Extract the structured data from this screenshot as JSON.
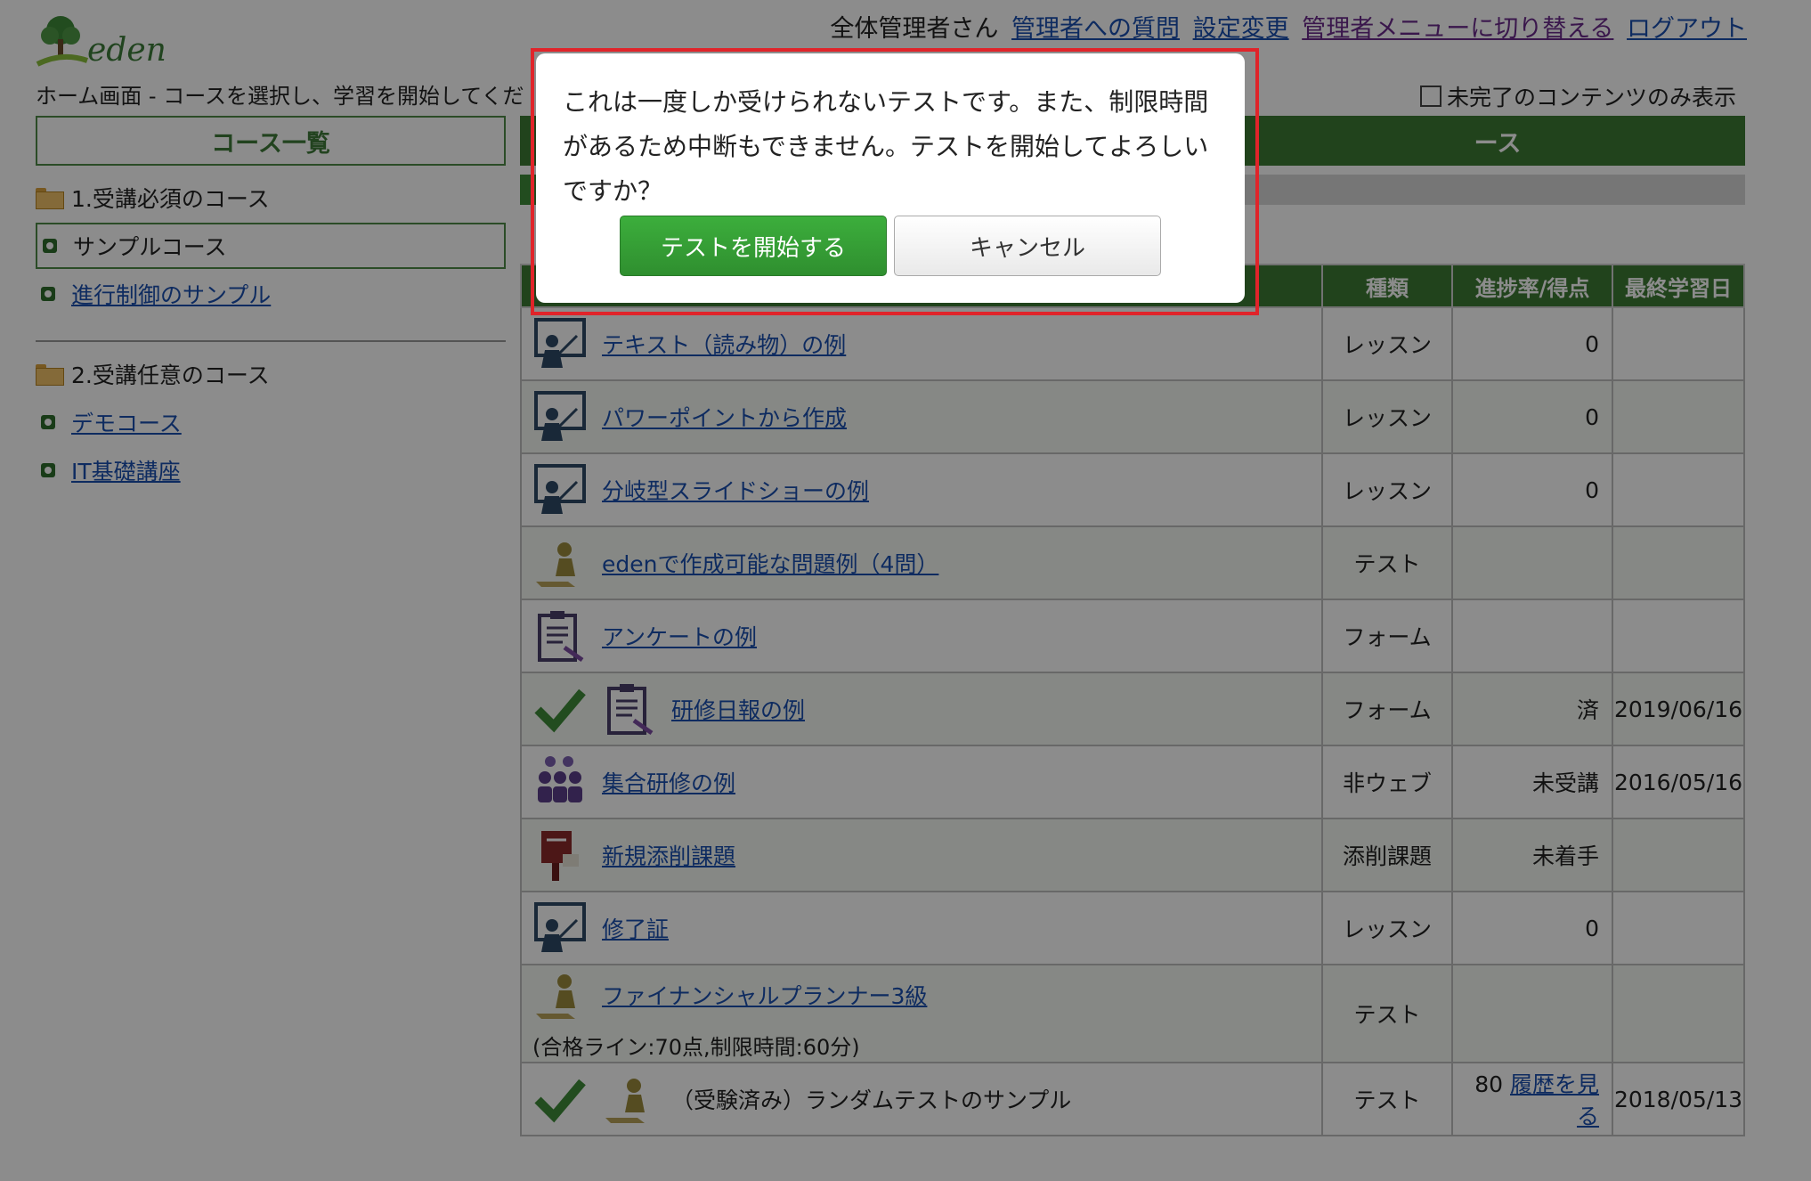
{
  "header": {
    "logo_text": "eden",
    "user_label": "全体管理者さん",
    "links": [
      "管理者への質問",
      "設定変更",
      "管理者メニューに切り替える",
      "ログアウト"
    ],
    "subtitle": "ホーム画面 - コースを選択し、学習を開始してくだ",
    "filter_label": "未完了のコンテンツのみ表示"
  },
  "sidebar": {
    "title": "コース一覧",
    "categories": [
      {
        "label": "1.受講必須のコース",
        "items": [
          "サンプルコース",
          "進行制御のサンプル"
        ]
      },
      {
        "label": "2.受講任意のコース",
        "items": [
          "デモコース",
          "IT基礎講座"
        ]
      }
    ]
  },
  "main": {
    "banner_suffix": "ース",
    "progress_fraction": 0.58
  },
  "table": {
    "headers": [
      "種類",
      "進捗率/得点",
      "最終学習日"
    ],
    "rows": [
      {
        "name": "テキスト（読み物）の例",
        "kind": "レッスン",
        "score": "0",
        "date": ""
      },
      {
        "name": "パワーポイントから作成",
        "kind": "レッスン",
        "score": "0",
        "date": ""
      },
      {
        "name": "分岐型スライドショーの例",
        "kind": "レッスン",
        "score": "0",
        "date": ""
      },
      {
        "name": "edenで作成可能な問題例（4問）",
        "kind": "テスト",
        "score": "",
        "date": ""
      },
      {
        "name": "アンケートの例",
        "kind": "フォーム",
        "score": "",
        "date": ""
      },
      {
        "name": "研修日報の例",
        "kind": "フォーム",
        "score": "済",
        "date": "2019/06/16"
      },
      {
        "name": "集合研修の例",
        "kind": "非ウェブ",
        "score": "未受講",
        "date": "2016/05/16"
      },
      {
        "name": "新規添削課題",
        "kind": "添削課題",
        "score": "未着手",
        "date": ""
      },
      {
        "name": "修了証",
        "kind": "レッスン",
        "score": "0",
        "date": ""
      },
      {
        "name": "ファイナンシャルプランナー3級",
        "note": "(合格ライン:70点,制限時間:60分)",
        "kind": "テスト",
        "score": "",
        "date": ""
      },
      {
        "name": "（受験済み）ランダムテストのサンプル",
        "kind": "テスト",
        "score": "80",
        "score_link": "履歴を見る",
        "date": "2018/05/13"
      }
    ]
  },
  "dialog": {
    "message": "これは一度しか受けられないテストです。また、制限時間があるため中断もできません。テストを開始してよろしいですか？",
    "ok_label": "テストを開始する",
    "cancel_label": "キャンセル"
  },
  "colors": {
    "brand_green": "#3d7a34",
    "link": "#1a4fb0",
    "highlight": "#e0242a"
  }
}
